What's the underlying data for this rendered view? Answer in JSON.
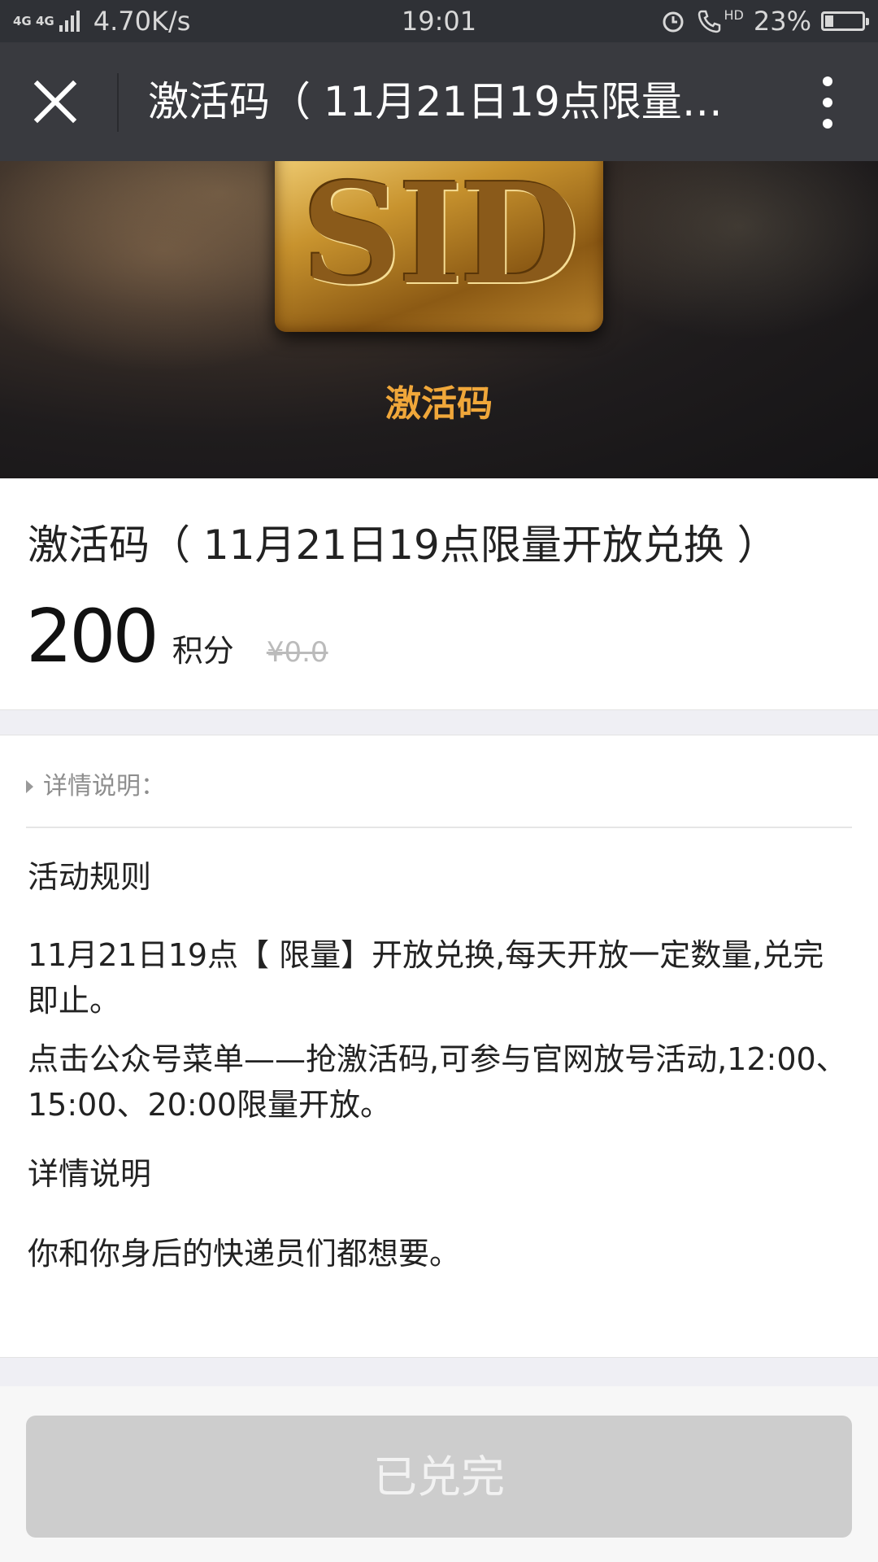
{
  "status_bar": {
    "network": "4G 4G",
    "speed": "4.70K/s",
    "time": "19:01",
    "hd": "HD",
    "battery": "23%",
    "battery_level": 0.23
  },
  "nav": {
    "title": "激活码（ 11月21日19点限量…",
    "close_icon": "close-icon",
    "more_icon": "more-vertical-icon"
  },
  "banner": {
    "logo_text": "SID",
    "label": "激活码"
  },
  "product": {
    "title": "激活码（ 11月21日19点限量开放兑换 ）",
    "price": "200",
    "price_unit": "积分",
    "original_price": "¥0.0"
  },
  "details": {
    "header": "详情说明：",
    "section1_title": "活动规则",
    "section1_para1": "11月21日19点【 限量】开放兑换,每天开放一定数量,兑完即止。",
    "section1_para2": "点击公众号菜单——抢激活码,可参与官网放号活动,12:00、15:00、20:00限量开放。",
    "section2_title": "详情说明",
    "section2_para": "你和你身后的快递员们都想要。"
  },
  "bottom": {
    "button_label": "已兑完"
  },
  "colors": {
    "nav_bg": "#393a3f",
    "status_bg": "#2f3136",
    "banner_label": "#f0a73a",
    "button_disabled": "#cdcdcd"
  }
}
